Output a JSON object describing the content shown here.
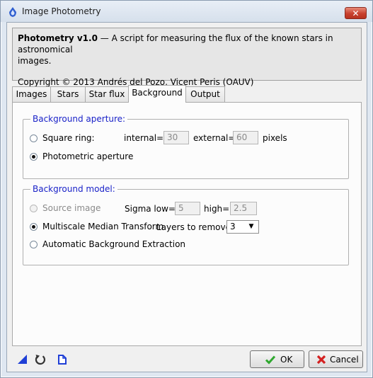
{
  "window": {
    "title": "Image Photometry"
  },
  "info": {
    "script_name": "Photometry v1.0",
    "description_part1": " — A script for measuring the flux of the known stars in astronomical",
    "description_part2": "images.",
    "copyright": "Copyright © 2013 Andrés del Pozo, Vicent Peris (OAUV)"
  },
  "tabs": [
    {
      "label": "Images",
      "active": false
    },
    {
      "label": "Stars",
      "active": false
    },
    {
      "label": "Star flux",
      "active": false
    },
    {
      "label": "Background",
      "active": true
    },
    {
      "label": "Output",
      "active": false
    }
  ],
  "background_aperture": {
    "legend": "Background aperture:",
    "square_ring_label": "Square ring:",
    "internal_label": "internal=",
    "internal_value": "30",
    "external_label": "external=",
    "external_value": "60",
    "units": "pixels",
    "photometric_aperture_label": "Photometric aperture",
    "selected": "photometric_aperture"
  },
  "background_model": {
    "legend": "Background model:",
    "source_image_label": "Source image",
    "sigma_low_label": "Sigma low=",
    "sigma_low_value": "5",
    "high_label": "high=",
    "high_value": "2.5",
    "mmt_label": "Multiscale Median Transform",
    "layers_label": "Layers to remove:",
    "layers_value": "3",
    "abe_label": "Automatic Background Extraction",
    "selected": "mmt"
  },
  "buttons": {
    "ok": "OK",
    "cancel": "Cancel"
  },
  "icons": {
    "app": "pixinsight-icon",
    "new_instance": "new-instance-icon",
    "reset": "reset-icon",
    "documentation": "documentation-icon",
    "ok": "check-icon",
    "cancel": "x-icon"
  },
  "colors": {
    "accent": "#1a22c8",
    "ok_green": "#2fa82f",
    "cancel_red": "#d42020"
  }
}
